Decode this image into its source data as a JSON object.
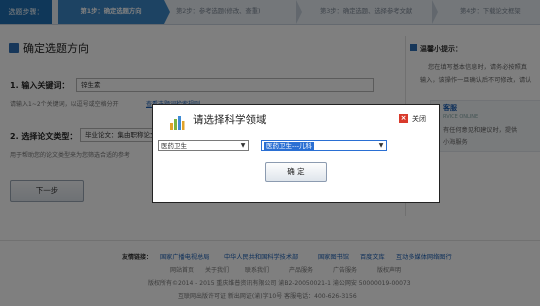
{
  "steps": {
    "label": "选题步骤：",
    "items": [
      {
        "label": "第1步：确定选题方向"
      },
      {
        "label": "第2步：参考选题(修改、查重)"
      },
      {
        "label": "第3步：确定选题、选择参考文献"
      },
      {
        "label": "第4步：下载论文框架"
      }
    ]
  },
  "main": {
    "title": "确定选题方向",
    "keyword_label": "1. 输入关键词：",
    "keyword_value": "锌生素",
    "keyword_hint": "请输入1~2个关键词，以逗号或空格分开",
    "keyword_link": "查看选题词检索规则",
    "type_label": "2. 选择论文类型：",
    "type_value": "毕业论文：集由职称论文",
    "type_hint": "用于帮助您的论文类型来为您筛选合适的参考",
    "next_button": "下一步"
  },
  "side": {
    "title": "温馨小提示：",
    "lines": [
      "您在填写基本信息时，请务必按照真",
      "输入，该操作一旦确认后不可修改，请认"
    ],
    "cs_title": "客服",
    "cs_subtitle": "RVICE ONLINE",
    "cs_lines": [
      "有任何意见和建议时，提供",
      "小海服务"
    ]
  },
  "footer": {
    "links_label": "友情链接：",
    "links": [
      "国家广播电视总局",
      "中华人民共和国科学技术部",
      "国家图书馆",
      "百度文库",
      "互动多媒体网络图行"
    ],
    "nav": [
      "网站首页",
      "关于我们",
      "联系我们",
      "产品服务",
      "广告服务",
      "版权声明"
    ],
    "copyright": "版权所有©2014 - 2015  重庆维普资讯有限公司  渝B2-20050021-1    渝公网安 50000019-00073",
    "icp": "互联网出版许可证  新出网证(渝)字10号   客服电话：400-626-3156"
  },
  "modal": {
    "title": "请选择科学领域",
    "close_label": "关闭",
    "field_value": "医药卫生",
    "subfield_value": "医药卫生---儿科",
    "ok_button": "确 定"
  },
  "colors": {
    "accent": "#1f6fb2",
    "active_step": "#3a86c6",
    "close_red": "#d93a2b",
    "overlay": "rgba(0,0,0,0.5)"
  },
  "icons": {
    "chart": "bar-chart-icon",
    "close": "close-icon",
    "dropdown": "chevron-down-icon"
  }
}
